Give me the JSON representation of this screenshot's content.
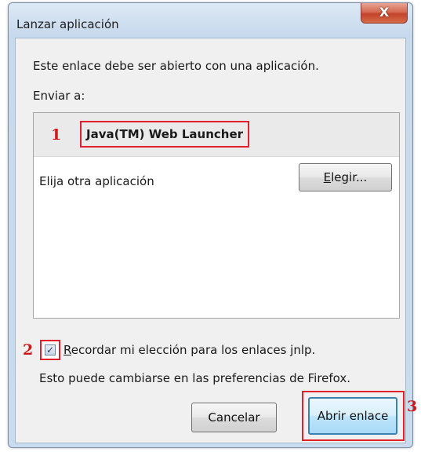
{
  "window": {
    "title": "Lanzar aplicación",
    "close_glyph": "X"
  },
  "dialog": {
    "intro": "Este enlace debe ser abierto con una aplicación.",
    "send_to_label": "Enviar a:",
    "selected_app": "Java(TM) Web Launcher",
    "other_app_label": "Elija otra aplicación",
    "choose_button": {
      "accel": "E",
      "rest": "legir..."
    },
    "remember": {
      "checked": true,
      "check_glyph": "✓",
      "accel": "R",
      "rest": "ecordar mi elección para los enlaces jnlp."
    },
    "prefs_note": "Esto puede cambiarse en las preferencias de Firefox.",
    "cancel_button": "Cancelar",
    "open_button": "Abrir enlace"
  },
  "annotations": {
    "marker_1": "1",
    "marker_2": "2",
    "marker_3": "3",
    "color": "#e0202a"
  },
  "icons": {
    "close": "close-icon",
    "checkbox": "checkmark-icon"
  }
}
